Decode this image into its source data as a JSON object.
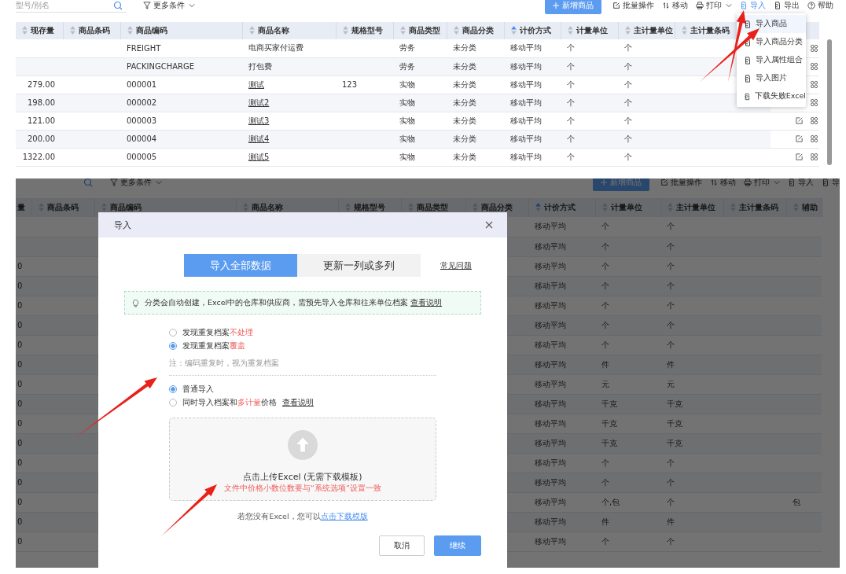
{
  "top": {
    "search": {
      "placeholder": "型号/别名"
    },
    "filter": "更多条件",
    "toolbar": [
      {
        "label": "新增商品",
        "kind": "primary",
        "selected": false
      },
      {
        "label": "批量操作",
        "kind": "edit",
        "selected": false
      },
      {
        "label": "移动",
        "kind": "move",
        "selected": false
      },
      {
        "label": "打印",
        "kind": "print",
        "selected": false
      },
      {
        "label": "导入",
        "kind": "import",
        "selected": true
      },
      {
        "label": "导出",
        "kind": "import",
        "selected": false
      },
      {
        "label": "帮助",
        "kind": "help",
        "selected": false
      }
    ],
    "columns": [
      {
        "label": "现存量",
        "sorted": false
      },
      {
        "label": "商品条码",
        "sorted": false
      },
      {
        "label": "商品编码",
        "sorted": false
      },
      {
        "label": "商品名称",
        "sorted": false
      },
      {
        "label": "规格型号",
        "sorted": false
      },
      {
        "label": "商品类型",
        "sorted": false
      },
      {
        "label": "商品分类",
        "sorted": false
      },
      {
        "label": "计价方式",
        "sorted": true
      },
      {
        "label": "计量单位",
        "sorted": false
      },
      {
        "label": "主计量单位",
        "sorted": false
      },
      {
        "label": "主计量条码",
        "sorted": false
      }
    ],
    "rows": [
      {
        "code": "FREIGHT",
        "name": "电商买家付运费",
        "linked": false,
        "type": "劳务",
        "category": "未分类",
        "pricing": "移动平均",
        "unit": "个",
        "main_unit": "个",
        "actions": [
          {
            "kind": "grid"
          }
        ]
      },
      {
        "code": "PACKINGCHARGE",
        "name": "打包费",
        "linked": false,
        "type": "劳务",
        "category": "未分类",
        "pricing": "移动平均",
        "unit": "个",
        "main_unit": "个",
        "actions": [
          {
            "kind": "grid"
          }
        ]
      },
      {
        "stock": "279.00",
        "code": "000001",
        "name": "测试",
        "linked": true,
        "spec": "123",
        "type": "实物",
        "category": "未分类",
        "pricing": "移动平均",
        "unit": "个",
        "main_unit": "个",
        "actions": [
          {
            "kind": "grid"
          }
        ]
      },
      {
        "stock": "198.00",
        "code": "000002",
        "name": "测试2",
        "linked": true,
        "type": "实物",
        "category": "未分类",
        "pricing": "移动平均",
        "unit": "个",
        "main_unit": "个",
        "actions": [
          {
            "kind": "grid"
          }
        ]
      },
      {
        "stock": "121.00",
        "code": "000003",
        "name": "测试3",
        "linked": true,
        "type": "实物",
        "category": "未分类",
        "pricing": "移动平均",
        "unit": "个",
        "main_unit": "个",
        "actions": [
          {
            "kind": "edit"
          },
          {
            "kind": "grid"
          }
        ]
      },
      {
        "stock": "200.00",
        "code": "000004",
        "name": "测试4",
        "linked": true,
        "type": "实物",
        "category": "未分类",
        "pricing": "移动平均",
        "unit": "个",
        "main_unit": "个",
        "actions": [
          {
            "kind": "edit"
          },
          {
            "kind": "grid"
          }
        ]
      },
      {
        "stock": "1322.00",
        "code": "000005",
        "name": "测试5",
        "linked": true,
        "type": "实物",
        "category": "未分类",
        "pricing": "移动平均",
        "unit": "个",
        "main_unit": "个",
        "actions": [
          {
            "kind": "edit"
          },
          {
            "kind": "grid"
          }
        ]
      }
    ],
    "menu": [
      {
        "label": "导入商品",
        "selected": true
      },
      {
        "label": "导入商品分类",
        "selected": false
      },
      {
        "label": "导入属性组合",
        "selected": false
      },
      {
        "label": "导入图片",
        "selected": false
      },
      {
        "label": "下载失败Excel",
        "selected": false
      }
    ]
  },
  "bottom": {
    "filter": "更多条件",
    "toolbar": [
      {
        "label": "新增商品",
        "kind": "primary"
      },
      {
        "label": "批量操作",
        "kind": "edit"
      },
      {
        "label": "移动",
        "kind": "move"
      },
      {
        "label": "打印",
        "kind": "print"
      },
      {
        "label": "导入",
        "kind": "import"
      },
      {
        "label": "导",
        "kind": "import"
      }
    ],
    "first_column_fragment": "量",
    "columns": [
      {
        "label": "商品条码",
        "sorted": false
      },
      {
        "label": "商品编码",
        "sorted": false
      },
      {
        "label": "商品名称",
        "sorted": false
      },
      {
        "label": "规格型号",
        "sorted": false
      },
      {
        "label": "商品类型",
        "sorted": false
      },
      {
        "label": "商品分类",
        "sorted": false
      },
      {
        "label": "计价方式",
        "sorted": true
      },
      {
        "label": "计量单位",
        "sorted": false
      },
      {
        "label": "主计量单位",
        "sorted": false
      },
      {
        "label": "主计量条码",
        "sorted": false
      },
      {
        "label": "辅助",
        "sorted": false
      }
    ],
    "rows": [
      {
        "pricing": "移动平均",
        "unit": "个",
        "main_unit": "个"
      },
      {
        "pricing": "移动平均",
        "unit": "个",
        "main_unit": "个"
      },
      {
        "stock": "0",
        "pricing": "移动平均",
        "unit": "个",
        "main_unit": "个"
      },
      {
        "stock": "0",
        "pricing": "移动平均",
        "unit": "个",
        "main_unit": "个"
      },
      {
        "stock": "0",
        "pricing": "移动平均",
        "unit": "个",
        "main_unit": "个"
      },
      {
        "stock": "0",
        "pricing": "移动平均",
        "unit": "个",
        "main_unit": "个"
      },
      {
        "stock": "0",
        "pricing": "移动平均",
        "unit": "个",
        "main_unit": "个"
      },
      {
        "stock": "0",
        "pricing": "移动平均",
        "unit": "件",
        "main_unit": "件"
      },
      {
        "stock": "0",
        "pricing": "移动平均",
        "unit": "元",
        "main_unit": "元"
      },
      {
        "stock": "0",
        "pricing": "移动平均",
        "unit": "千克",
        "main_unit": "千克"
      },
      {
        "stock": "0",
        "pricing": "移动平均",
        "unit": "千克",
        "main_unit": "千克"
      },
      {
        "stock": "0",
        "pricing": "移动平均",
        "unit": "千克",
        "main_unit": "千克"
      },
      {
        "stock": "0",
        "pricing": "移动平均",
        "unit": "个",
        "main_unit": "个"
      },
      {
        "stock": "0",
        "pricing": "移动平均",
        "unit": "个",
        "main_unit": "个"
      },
      {
        "stock": "0",
        "pricing": "移动平均",
        "unit": "个,包",
        "main_unit": "个",
        "aux": "包"
      },
      {
        "stock": "0",
        "pricing": "移动平均",
        "unit": "件",
        "main_unit": "件"
      },
      {
        "stock": "0",
        "pricing": "移动平均",
        "unit": "个",
        "main_unit": "个"
      }
    ],
    "dialog": {
      "title": "导入",
      "tabs": [
        {
          "label": "导入全部数据",
          "selected": true
        },
        {
          "label": "更新一列或多列",
          "selected": false
        }
      ],
      "faq_link": "常见问题",
      "notice": {
        "text": "分类会自动创建，Excel中的仓库和供应商，需预先导入仓库和往来单位档案",
        "link": "查看说明"
      },
      "duplicate_options": [
        {
          "parts": [
            {
              "text": "发现重复档案",
              "kind": "plain"
            },
            {
              "text": "不处理",
              "kind": "warn"
            }
          ],
          "selected": false
        },
        {
          "parts": [
            {
              "text": "发现重复档案",
              "kind": "plain"
            },
            {
              "text": "覆盖",
              "kind": "warn"
            }
          ],
          "selected": true
        }
      ],
      "note": "注：编码重复时，视为重复档案",
      "import_modes": [
        {
          "parts": [
            {
              "text": "普通导入",
              "kind": "plain"
            }
          ],
          "selected": true
        },
        {
          "parts": [
            {
              "text": "同时导入档案和",
              "kind": "plain"
            },
            {
              "text": "多计量",
              "kind": "warn"
            },
            {
              "text": "价格",
              "kind": "plain"
            }
          ],
          "link": "查看说明",
          "selected": false
        }
      ],
      "upload": {
        "label": "点击上传Excel (无需下载模板)",
        "hint": "文件中价格小数位数要与“系统选项”设置一致"
      },
      "template_hint": {
        "text": "若您没有Excel，您可以",
        "link": "点击下载模版"
      },
      "buttons": [
        {
          "label": "取消",
          "kind": "secondary"
        },
        {
          "label": "继续",
          "kind": "primary"
        }
      ]
    }
  }
}
